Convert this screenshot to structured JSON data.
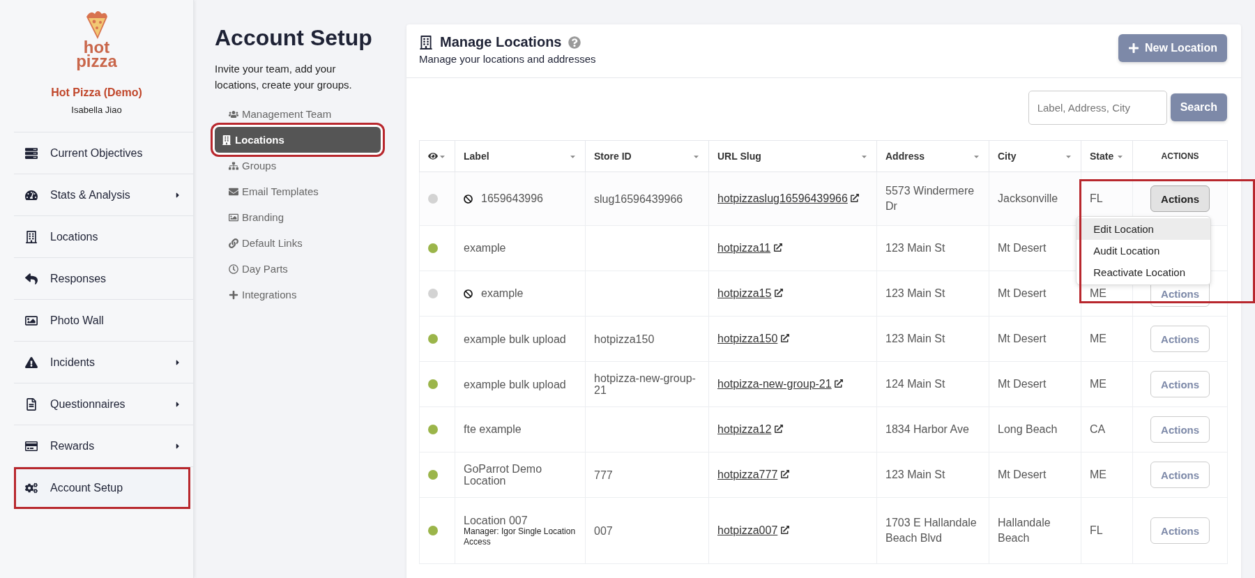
{
  "brand": {
    "logo_top": "hot",
    "logo_bottom": "pizza",
    "org": "Hot Pizza (Demo)",
    "user": "Isabella Jiao"
  },
  "sidebar": {
    "items": [
      {
        "label": "Current Objectives",
        "has_submenu": false,
        "selected": false
      },
      {
        "label": "Stats & Analysis",
        "has_submenu": true,
        "selected": false
      },
      {
        "label": "Locations",
        "has_submenu": false,
        "selected": false
      },
      {
        "label": "Responses",
        "has_submenu": false,
        "selected": false
      },
      {
        "label": "Photo Wall",
        "has_submenu": false,
        "selected": false
      },
      {
        "label": "Incidents",
        "has_submenu": true,
        "selected": false
      },
      {
        "label": "Questionnaires",
        "has_submenu": true,
        "selected": false
      },
      {
        "label": "Rewards",
        "has_submenu": true,
        "selected": false
      },
      {
        "label": "Account Setup",
        "has_submenu": false,
        "selected": true
      }
    ]
  },
  "setup": {
    "title": "Account Setup",
    "description": "Invite your team, add your locations, create your groups.",
    "items": [
      {
        "label": "Management Team",
        "selected": false
      },
      {
        "label": "Locations",
        "selected": true
      },
      {
        "label": "Groups",
        "selected": false
      },
      {
        "label": "Email Templates",
        "selected": false
      },
      {
        "label": "Branding",
        "selected": false
      },
      {
        "label": "Default Links",
        "selected": false
      },
      {
        "label": "Day Parts",
        "selected": false
      },
      {
        "label": "Integrations",
        "selected": false
      }
    ]
  },
  "panel": {
    "title": "Manage Locations",
    "subtitle": "Manage your locations and addresses",
    "new_button": "New Location",
    "search": {
      "placeholder": "Label, Address, City"
    },
    "search_button": "Search"
  },
  "table": {
    "columns": [
      "Label",
      "Store ID",
      "URL Slug",
      "Address",
      "City",
      "State",
      "ACTIONS"
    ],
    "rows": [
      {
        "active": false,
        "label": "1659643996",
        "store_id": "slug16596439966",
        "url_slug": "hotpizzaslug16596439966",
        "address": "5573 Windermere Dr",
        "city": "Jacksonville",
        "state": "FL",
        "action": "Actions",
        "open": true
      },
      {
        "active": true,
        "label": "example",
        "store_id": "",
        "url_slug": "hotpizza11",
        "address": "123 Main St",
        "city": "Mt Desert",
        "open": false
      },
      {
        "active": false,
        "label": "example",
        "store_id": "",
        "url_slug": "hotpizza15",
        "address": "123 Main St",
        "city": "Mt Desert",
        "state": "ME",
        "action": "Actions",
        "open": false
      },
      {
        "active": true,
        "label": "example bulk upload",
        "store_id": "hotpizza150",
        "url_slug": "hotpizza150",
        "address": "123 Main St",
        "city": "Mt Desert",
        "state": "ME",
        "action": "Actions",
        "open": false
      },
      {
        "active": true,
        "label": "example bulk upload",
        "store_id": "hotpizza-new-group-21",
        "url_slug": "hotpizza-new-group-21",
        "address": "124 Main St",
        "city": "Mt Desert",
        "state": "ME",
        "action": "Actions",
        "open": false
      },
      {
        "active": true,
        "label": "fte example",
        "store_id": "",
        "url_slug": "hotpizza12",
        "address": "1834 Harbor Ave",
        "city": "Long Beach",
        "state": "CA",
        "action": "Actions",
        "open": false
      },
      {
        "active": true,
        "label": "GoParrot Demo Location",
        "store_id": "777",
        "url_slug": "hotpizza777",
        "address": "123 Main St",
        "city": "Mt Desert",
        "state": "ME",
        "action": "Actions",
        "open": false
      },
      {
        "active": true,
        "label": "Location 007",
        "manager": "Manager: Igor Single Location Access",
        "store_id": "007",
        "url_slug": "hotpizza007",
        "address": "1703 E Hallandale Beach Blvd",
        "city": "Hallandale Beach",
        "state": "FL",
        "action": "Actions",
        "open": false
      }
    ]
  },
  "action_menu": {
    "items": [
      {
        "label": "Edit Location",
        "selected": true
      },
      {
        "label": "Audit Location",
        "selected": false
      },
      {
        "label": "Reactivate Location",
        "selected": false
      }
    ]
  }
}
